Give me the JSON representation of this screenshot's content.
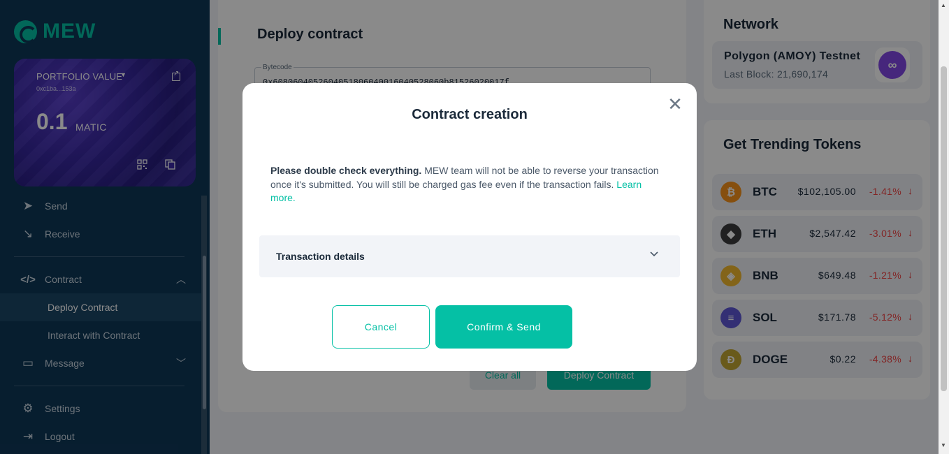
{
  "app": {
    "logo_text": "MEW"
  },
  "portfolio": {
    "label": "PORTFOLIO VALUE",
    "address": "0xc1ba...153a",
    "balance": "0.1",
    "unit": "MATIC"
  },
  "sidebar": {
    "send": "Send",
    "receive": "Receive",
    "contract": "Contract",
    "deploy_contract": "Deploy Contract",
    "interact_contract": "Interact with Contract",
    "message": "Message",
    "settings": "Settings",
    "logout": "Logout"
  },
  "main": {
    "title": "Deploy contract",
    "bytecode_label": "Bytecode",
    "bytecode_value": "0x6080604052604051806040016040528060b81526020017f",
    "clear_all": "Clear all",
    "deploy_button": "Deploy Contract"
  },
  "network": {
    "title": "Network",
    "name": "Polygon (AMOY) Testnet",
    "last_block": "Last Block: 21,690,174"
  },
  "trending": {
    "title": "Get Trending Tokens",
    "tokens": [
      {
        "symbol": "BTC",
        "price": "$102,105.00",
        "change": "-1.41%",
        "color": "#f7931a",
        "glyph": "₿"
      },
      {
        "symbol": "ETH",
        "price": "$2,547.42",
        "change": "-3.01%",
        "color": "#3c3c3d",
        "glyph": "◆"
      },
      {
        "symbol": "BNB",
        "price": "$649.48",
        "change": "-1.21%",
        "color": "#f3ba2f",
        "glyph": "◈"
      },
      {
        "symbol": "SOL",
        "price": "$171.78",
        "change": "-5.12%",
        "color": "#5e58d6",
        "glyph": "≡"
      },
      {
        "symbol": "DOGE",
        "price": "$0.22",
        "change": "-4.38%",
        "color": "#c2a633",
        "glyph": "Ð"
      }
    ]
  },
  "modal": {
    "title": "Contract creation",
    "warning_bold": "Please double check everything.",
    "warning_text": " MEW team will not be able to reverse your transaction once it's submitted. You will still be charged gas fee even if the transaction fails. ",
    "learn_more": "Learn more.",
    "tx_details": "Transaction details",
    "cancel": "Cancel",
    "confirm": "Confirm & Send"
  }
}
